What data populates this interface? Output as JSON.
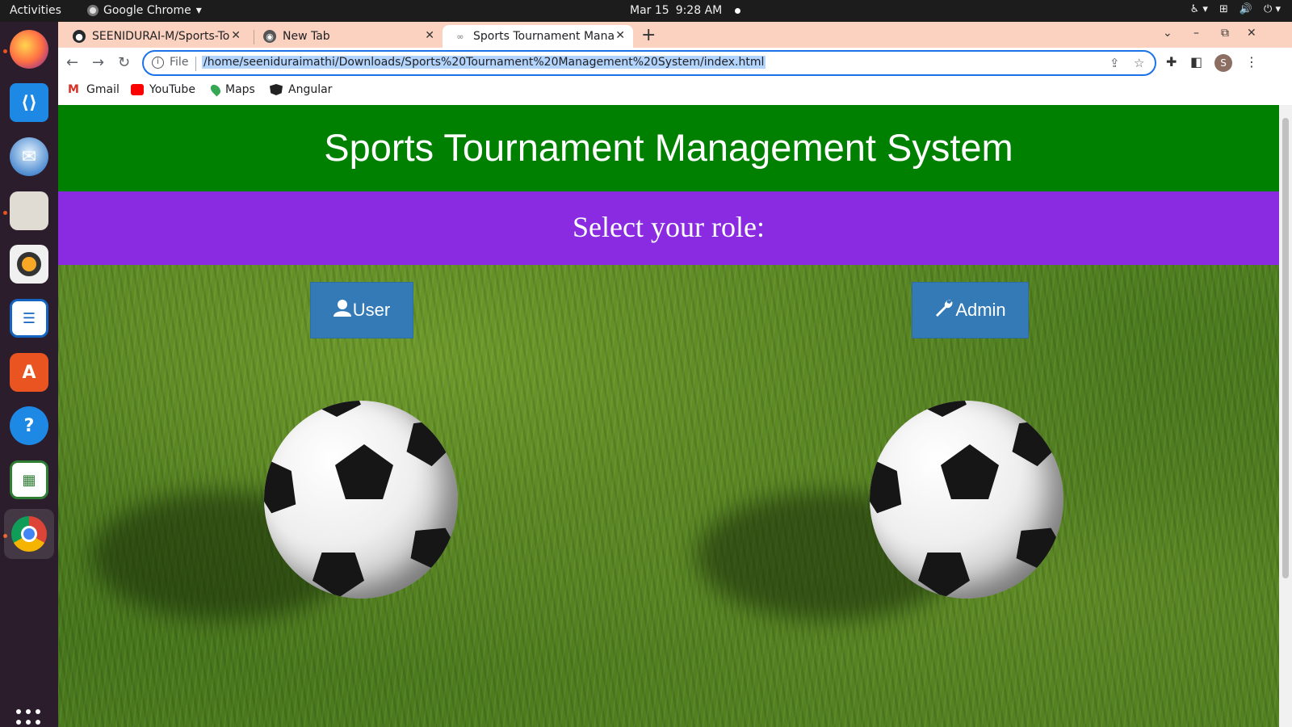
{
  "os": {
    "activities": "Activities",
    "app_menu": "Google Chrome",
    "date": "Mar 15",
    "time": "9:28 AM"
  },
  "dock": {
    "items": [
      "firefox-icon",
      "vscode-icon",
      "thunderbird-icon",
      "files-icon",
      "rhythmbox-icon",
      "writer-icon",
      "software-icon",
      "help-icon",
      "calc-icon",
      "chrome-icon"
    ]
  },
  "browser": {
    "tabs": [
      {
        "title": "SEENIDURAI-M/Sports-To",
        "favicon": "github-icon"
      },
      {
        "title": "New Tab",
        "favicon": "chrome-icon"
      },
      {
        "title": "Sports Tournament Mana",
        "favicon": "page-icon"
      }
    ],
    "active_tab": 2,
    "address": {
      "scheme": "File",
      "url": "/home/seeniduraimathi/Downloads/Sports%20Tournament%20Management%20System/index.html"
    },
    "profile_initial": "S",
    "bookmarks": [
      {
        "label": "Gmail",
        "icon": "gmail-icon"
      },
      {
        "label": "YouTube",
        "icon": "youtube-icon"
      },
      {
        "label": "Maps",
        "icon": "maps-icon"
      },
      {
        "label": "Angular",
        "icon": "angular-icon"
      }
    ]
  },
  "page": {
    "title": "Sports Tournament Management System",
    "subtitle": "Select your role:",
    "buttons": {
      "user": {
        "label": "User",
        "icon": "user-icon"
      },
      "admin": {
        "label": "Admin",
        "icon": "wrench-icon"
      }
    },
    "colors": {
      "header_bg": "#008000",
      "role_bar_bg": "#8a2be2",
      "button_bg": "#337ab7"
    }
  }
}
